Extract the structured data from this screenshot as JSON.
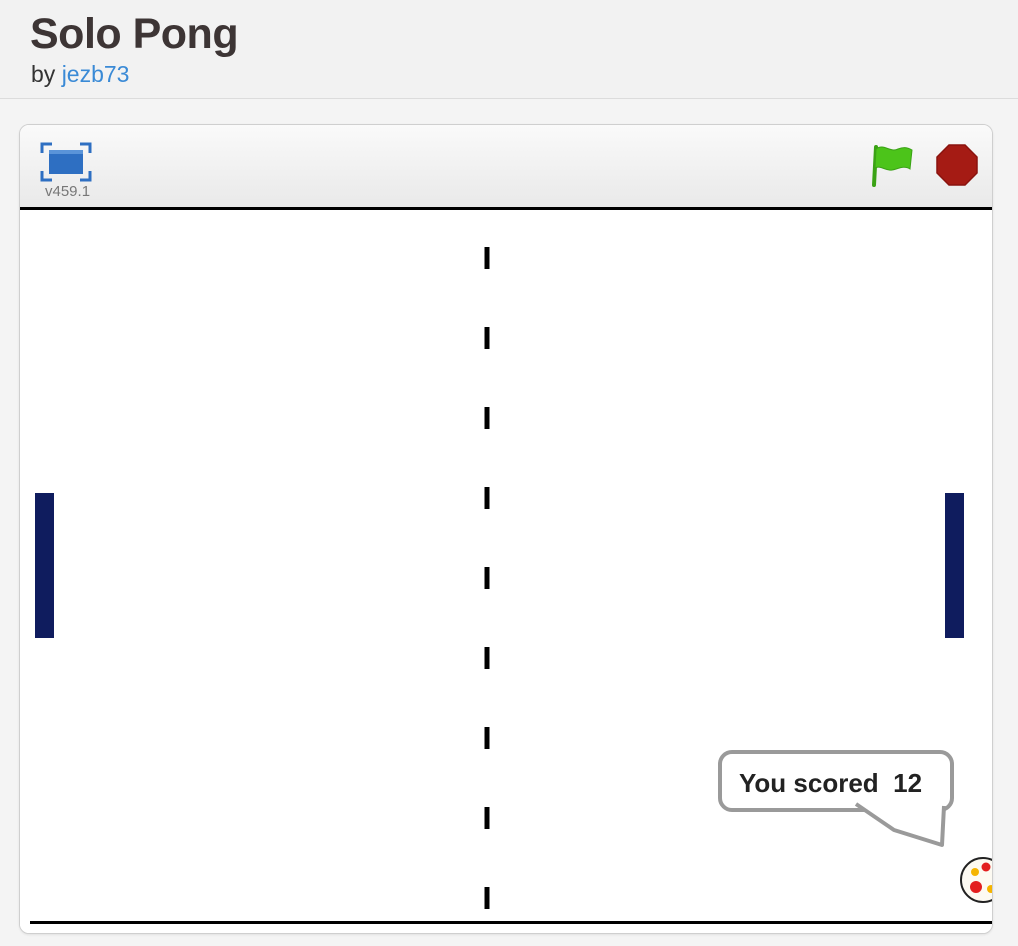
{
  "project": {
    "title": "Solo Pong",
    "by_label": "by",
    "author": "jezb73"
  },
  "player": {
    "version": "v459.1",
    "icons": {
      "fullscreen": "fullscreen-icon",
      "green_flag": "green-flag-icon",
      "stop": "stop-sign-icon"
    },
    "colors": {
      "fullscreen": "#2e6fc2",
      "flag": "#4cc41a",
      "stop": "#a51b14",
      "paddle": "#0f1c5e"
    }
  },
  "stage": {
    "speech_bubble": "You scored  12"
  }
}
